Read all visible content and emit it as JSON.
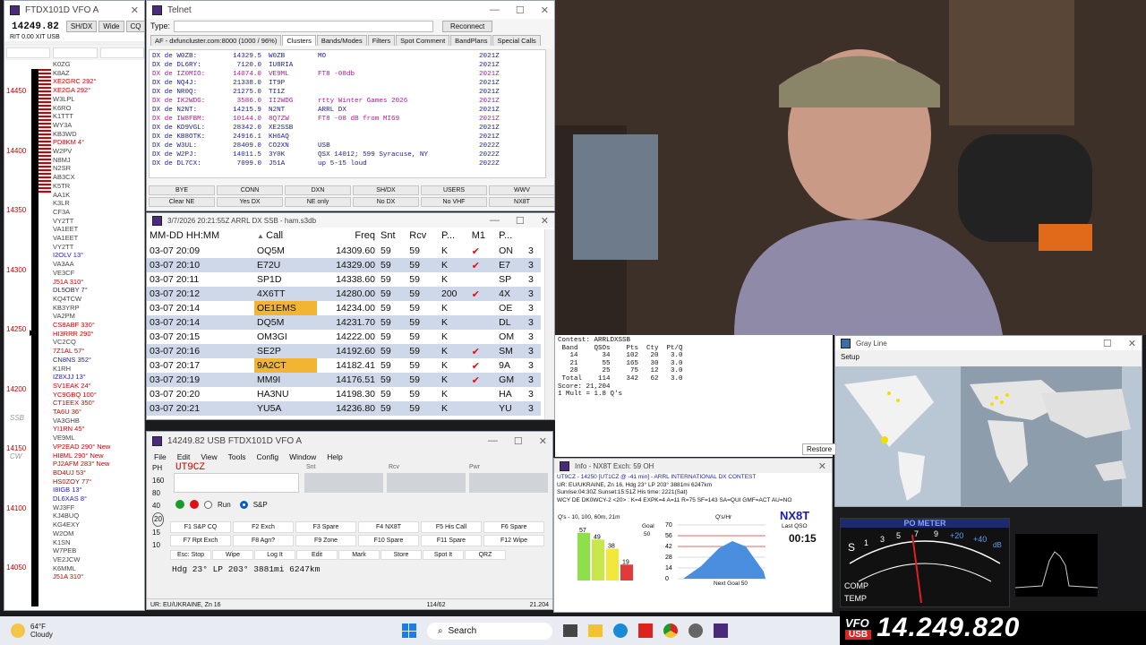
{
  "bandmap": {
    "title": "FTDX101D VFO A",
    "freq": "14249.82",
    "buttons": [
      "SH/DX",
      "Wide",
      "CQ"
    ],
    "rit": "RIT 0.00 XIT USB",
    "scale": [
      "14450",
      "14400",
      "14350",
      "14300",
      "14250",
      "14200",
      "14150",
      "14100",
      "14050"
    ],
    "ssb_label": "SSB",
    "cw_label": "CW",
    "spots": [
      {
        "t": "K0ZG",
        "c": "#444"
      },
      {
        "t": "K8AZ",
        "c": "#444"
      },
      {
        "t": "XE2GRC 292°",
        "c": "#c00"
      },
      {
        "t": "XE2GA 292°",
        "c": "#c00"
      },
      {
        "t": "W3LPL",
        "c": "#444"
      },
      {
        "t": "K6RO",
        "c": "#444"
      },
      {
        "t": "K1TTT",
        "c": "#444"
      },
      {
        "t": "WY3A",
        "c": "#444"
      },
      {
        "t": "KB3WD",
        "c": "#444"
      },
      {
        "t": "PD8KM 4°",
        "c": "#c00"
      },
      {
        "t": "W2PV",
        "c": "#444"
      },
      {
        "t": "N8MJ",
        "c": "#444"
      },
      {
        "t": "N2SR",
        "c": "#444"
      },
      {
        "t": "AB3CX",
        "c": "#444"
      },
      {
        "t": "K5TR",
        "c": "#444"
      },
      {
        "t": "AA1K",
        "c": "#444"
      },
      {
        "t": "K3LR",
        "c": "#444"
      },
      {
        "t": "CF3A",
        "c": "#444"
      },
      {
        "t": "VY2TT",
        "c": "#444"
      },
      {
        "t": "VA1EET",
        "c": "#444"
      },
      {
        "t": "VA1EET",
        "c": "#444"
      },
      {
        "t": "VY2TT",
        "c": "#444"
      },
      {
        "t": "I2OLV 13°",
        "c": "#22a"
      },
      {
        "t": "VA3AA",
        "c": "#444"
      },
      {
        "t": "VE3CF",
        "c": "#444"
      },
      {
        "t": "J51A 310°",
        "c": "#c00"
      },
      {
        "t": "DL5OBY 7°",
        "c": "#22a"
      },
      {
        "t": "KQ4TCW",
        "c": "#444"
      },
      {
        "t": "KB3YRP",
        "c": "#444"
      },
      {
        "t": "VA2PM",
        "c": "#444"
      },
      {
        "t": "CS8ABF 330°",
        "c": "#c00"
      },
      {
        "t": "HI3RRR 290°",
        "c": "#c00"
      },
      {
        "t": "VC2CQ",
        "c": "#444"
      },
      {
        "t": "7Z1AL 57°",
        "c": "#c00"
      },
      {
        "t": "CN8NS 352°",
        "c": "#22a"
      },
      {
        "t": "K1RH",
        "c": "#444"
      },
      {
        "t": "IZ8XJJ 13°",
        "c": "#22a"
      },
      {
        "t": "SV1EAK 24°",
        "c": "#c00"
      },
      {
        "t": "YC9GBQ 100°",
        "c": "#c00"
      },
      {
        "t": "CT1EEX 350°",
        "c": "#c00"
      },
      {
        "t": "TA6U 36°",
        "c": "#c00"
      },
      {
        "t": "VA3GHB",
        "c": "#444"
      },
      {
        "t": "YI1RN 45°",
        "c": "#c00"
      },
      {
        "t": "VE9ML",
        "c": "#444"
      },
      {
        "t": "VP2EAD 290° New",
        "c": "#c00"
      },
      {
        "t": "HI8ML 290° New",
        "c": "#c00"
      },
      {
        "t": "PJ2AFM 283° New",
        "c": "#c00"
      },
      {
        "t": "BD4UJ 53°",
        "c": "#c00"
      },
      {
        "t": "HS0ZOY 77°",
        "c": "#c00"
      },
      {
        "t": "I8IGB 13°",
        "c": "#22a"
      },
      {
        "t": "DL6XAS 8°",
        "c": "#22a"
      },
      {
        "t": "WJ3FF",
        "c": "#444"
      },
      {
        "t": "KJ4BUQ",
        "c": "#444"
      },
      {
        "t": "KG4EXY",
        "c": "#444"
      },
      {
        "t": "W2OM",
        "c": "#444"
      },
      {
        "t": "K1SN",
        "c": "#444"
      },
      {
        "t": "W7PEB",
        "c": "#444"
      },
      {
        "t": "VE2JCW",
        "c": "#444"
      },
      {
        "t": "K6MML",
        "c": "#444"
      },
      {
        "t": "J51A 310°",
        "c": "#c00"
      }
    ]
  },
  "telnet": {
    "title": "Telnet",
    "type_label": "Type:",
    "reconnect": "Reconnect",
    "tabs": [
      "AF - dxfuncluster.com:8000 (1000 / 96%)",
      "Clusters",
      "Bands/Modes",
      "Filters",
      "Spot Comment",
      "BandPlans",
      "Special Calls"
    ],
    "spots": [
      [
        "DX de W0ZB:",
        "14329.5",
        "W0ZB",
        "MO",
        "2021Z"
      ],
      [
        "DX de DL6RY:",
        "7120.0",
        "IU8RIA",
        "",
        "2021Z"
      ],
      [
        "DX de IZ0MIO:",
        "14074.0",
        "VE9ML",
        "FT8 -08db",
        "2021Z"
      ],
      [
        "DX de NQ4J:",
        "21338.0",
        "IT9P",
        "",
        "2021Z"
      ],
      [
        "DX de NR0Q:",
        "21275.0",
        "TI1Z",
        "",
        "2021Z"
      ],
      [
        "DX de IK2WDG:",
        "3586.0",
        "II2WDG",
        "rtty Winter Games 2026",
        "2021Z"
      ],
      [
        "DX de N2NT:",
        "14215.9",
        "N2NT",
        "ARRL DX",
        "2021Z"
      ],
      [
        "DX de IW8FBM:",
        "10144.0",
        "8Q7ZW",
        "FT8 -08 dB from MI69",
        "2021Z"
      ],
      [
        "DX de KD9VGL:",
        "28342.0",
        "XE2SSB",
        "",
        "2021Z"
      ],
      [
        "DX de KB8OTK:",
        "24916.1",
        "KH6AQ",
        "",
        "2021Z"
      ],
      [
        "DX de W3UL:",
        "28409.0",
        "CO2XN",
        "USB",
        "2022Z"
      ],
      [
        "DX de W2PJ:",
        "14011.5",
        "3Y0K",
        "QSX 14012; 599 Syracuse, NY",
        "2022Z"
      ],
      [
        "DX de DL7CX:",
        "7099.0",
        "J51A",
        "up 5-15 loud",
        "2022Z"
      ]
    ],
    "macros": [
      "BYE",
      "CONN",
      "DXN",
      "SH/DX",
      "USERS",
      "WWV",
      "Clear NE",
      "Yes DX",
      "NE only",
      "No DX",
      "No VHF",
      "NX8T"
    ]
  },
  "log": {
    "title": "3/7/2026 20:21:55Z  ARRL DX SSB - ham.s3db",
    "headers": [
      "MM-DD HH:MM",
      "Call",
      "Freq",
      "Snt",
      "Rcv",
      "P...",
      "M1",
      "P..."
    ],
    "rows": [
      [
        "03-07 20:09",
        "OQ5M",
        "14309.60",
        "59",
        "59",
        "K",
        "✔",
        "ON",
        "3"
      ],
      [
        "03-07 20:10",
        "E72U",
        "14329.00",
        "59",
        "59",
        "K",
        "✔",
        "E7",
        "3"
      ],
      [
        "03-07 20:11",
        "SP1D",
        "14338.60",
        "59",
        "59",
        "K",
        "",
        "SP",
        "3"
      ],
      [
        "03-07 20:12",
        "4X6TT",
        "14280.00",
        "59",
        "59",
        "200",
        "✔",
        "4X",
        "3"
      ],
      [
        "03-07 20:14",
        "OE1EMS",
        "14234.00",
        "59",
        "59",
        "K",
        "",
        "OE",
        "3"
      ],
      [
        "03-07 20:14",
        "DQ5M",
        "14231.70",
        "59",
        "59",
        "K",
        "",
        "DL",
        "3"
      ],
      [
        "03-07 20:15",
        "OM3GI",
        "14222.00",
        "59",
        "59",
        "K",
        "",
        "OM",
        "3"
      ],
      [
        "03-07 20:16",
        "SE2P",
        "14192.60",
        "59",
        "59",
        "K",
        "✔",
        "SM",
        "3"
      ],
      [
        "03-07 20:17",
        "9A2CT",
        "14182.41",
        "59",
        "59",
        "K",
        "✔",
        "9A",
        "3"
      ],
      [
        "03-07 20:19",
        "MM9I",
        "14176.51",
        "59",
        "59",
        "K",
        "✔",
        "GM",
        "3"
      ],
      [
        "03-07 20:20",
        "HA3NU",
        "14198.30",
        "59",
        "59",
        "K",
        "",
        "HA",
        "3"
      ],
      [
        "03-07 20:21",
        "YU5A",
        "14236.80",
        "59",
        "59",
        "K",
        "",
        "YU",
        "3"
      ]
    ],
    "highlight_calls": [
      "OE1EMS",
      "SE2P",
      "9A2CT",
      "MM9I"
    ]
  },
  "entry": {
    "title": "14249.82 USB FTDX101D VFO A",
    "menu": [
      "File",
      "Edit",
      "View",
      "Tools",
      "Config",
      "Window",
      "Help"
    ],
    "callsign": "UT9CZ",
    "field_labels": [
      "Snt",
      "Rcv",
      "Pwr"
    ],
    "bands": [
      "PH",
      "160",
      "80",
      "40",
      "20",
      "15",
      "10"
    ],
    "run_label": "Run",
    "sp_label": "S&P",
    "fkeys": [
      "F1 S&P CQ",
      "F2 Exch",
      "F3 Spare",
      "F4 NX8T",
      "F5 His Call",
      "F6 Spare",
      "F7 Rpt Exch",
      "F8 Agn?",
      "F9 Zone",
      "F10 Spare",
      "F11 Spare",
      "F12 Wipe"
    ],
    "actions": [
      "Esc: Stop",
      "Wipe",
      "Log It",
      "Edit",
      "Mark",
      "Store",
      "Spot It",
      "QRZ"
    ],
    "heading": "Hdg 23° LP 203° 3881mi 6247km",
    "status_left": "UR: EU/UKRAINE, Zn 16",
    "status_mid": "114/62",
    "status_right": "21.204"
  },
  "score": {
    "text": "Contest: ARRLDXSSB\n Band    QSOs    Pts  Cty  Pt/Q\n   14      34    102   20   3.0\n   21      55    165   30   3.0\n   28      25     75   12   3.0\n Total    114    342   62   3.0\nScore: 21,204\n1 Mult = 1.8 Q's"
  },
  "info": {
    "title": "Info - NX8T Exch: 59 OH",
    "line1": "UT9CZ - 14250 [UT1CZ @ -41 min] - ARRL INTERNATIONAL DX CONTEST",
    "line2": "UR: EU/UKRAINE, Zn 16, Hdg 23° LP 203° 3881mi 6247km",
    "line3": "Sunrise:04:30Z Sunset:15:51Z His time: 2221(Sat)",
    "line4": "WCY DE DK0WCY-2 <20> : K=4 EXPK=4 A=11 R=75 SF=143 SA=QUI GMF=ACT AU=NO",
    "qs_label": "Q's - 10, 100, 60m, 21m",
    "bars": [
      57,
      49,
      38,
      19
    ],
    "goal_label": "Goal",
    "goal_value": "50",
    "qshr_label": "Q's/Hr",
    "qshr_ticks": [
      "70",
      "56",
      "42",
      "28",
      "14",
      "0"
    ],
    "next_goal": "Next Goal 50",
    "callsign": "NX8T",
    "last_qso_label": "Last QSO",
    "last_qso": "00:15"
  },
  "gray": {
    "title": "Gray Line",
    "menu": "Setup",
    "restore": "Restore"
  },
  "meter": {
    "title": "PO METER",
    "labels": [
      "S",
      "1",
      "3",
      "5",
      "7",
      "9",
      "+20",
      "+40",
      "dB",
      "COMP",
      "TEMP"
    ],
    "vfo_label": "VFO",
    "mode": "USB",
    "freq": "14.249.820"
  },
  "taskbar": {
    "temp": "64°F",
    "weather": "Cloudy",
    "search": "Search"
  }
}
